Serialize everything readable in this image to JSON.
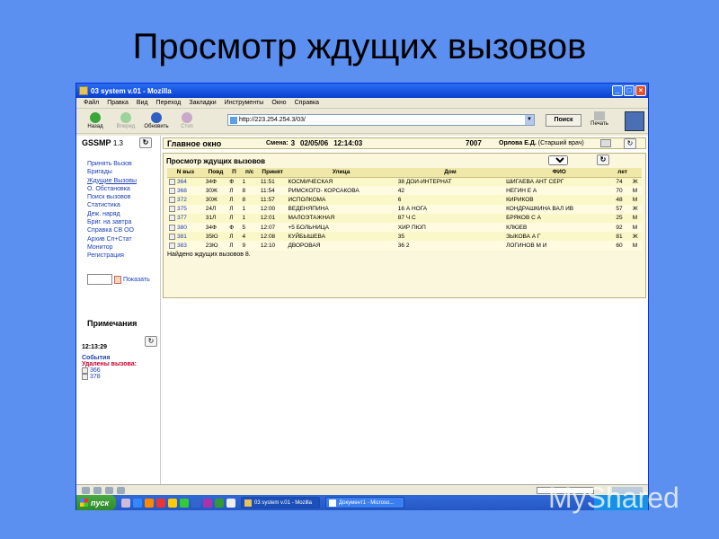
{
  "slide": {
    "title": "Просмотр ждущих вызовов"
  },
  "window": {
    "title": "03 system v.01 - Mozilla"
  },
  "menu": [
    "Файл",
    "Правка",
    "Вид",
    "Переход",
    "Закладки",
    "Инструменты",
    "Окно",
    "Справка"
  ],
  "toolbar": {
    "back": "Назад",
    "forward": "Вперед",
    "reload": "Обновить",
    "stop": "Стоп",
    "url": "http://223.254.254.3/03/",
    "search": "Поиск",
    "print": "Печать"
  },
  "left": {
    "app": "GSSMP",
    "version": "1.3",
    "nav": [
      "Принять Вызов",
      "Бригады",
      "Ждущие Вызовы",
      "О. Обстановка",
      "Поиск вызовов",
      "Статистика",
      "Деж. наряд",
      "Бриг. на завтра",
      "Справка СВ ОО",
      "Архив Сп+Стат",
      "Монитор",
      "Регистрация"
    ],
    "show_label": "Показать",
    "notes_title": "Примечания",
    "notes_time": "12:13:29",
    "events": "События",
    "deleted_label": "Удалены вызова:",
    "deleted": [
      "366",
      "378"
    ]
  },
  "header": {
    "title": "Главное окно",
    "shift_label": "Смена:",
    "shift_value": "3",
    "date": "02/05/06",
    "time": "12:14:03",
    "id": "7007",
    "user": "Орлова Е.Д.",
    "role": "(Старший врач)"
  },
  "panel": {
    "title": "Просмотр ждущих вызовов",
    "page_select": "1",
    "columns": [
      "N выз",
      "Повд",
      "П",
      "п/с",
      "Принят",
      "Улица",
      "Дом",
      "ФИО",
      "лет",
      ""
    ],
    "rows": [
      [
        "364",
        "34Ф",
        "Ф",
        "1",
        "11:51",
        "КОСМИЧЕСКАЯ",
        "38 ДОИ-ИНТЕРНАТ",
        "ШИГАЕВА АНТ СЕРГ",
        "74",
        "Ж"
      ],
      [
        "368",
        "30Ж",
        "Л",
        "8",
        "11:54",
        "РИМСКОГО- КОРСАКОВА",
        "42",
        "НЕГИН Е А",
        "70",
        "М"
      ],
      [
        "372",
        "30Ж",
        "Л",
        "8",
        "11:57",
        "ИСПОЛКОМА",
        "6",
        "КИРИКОВ",
        "48",
        "М"
      ],
      [
        "375",
        "24Л",
        "Л",
        "1",
        "12:00",
        "ВЕДЕНЯПИНА",
        "16 А НОГА",
        "КОНДРАШКИНА ВАЛ ИВ",
        "57",
        "Ж"
      ],
      [
        "377",
        "31Л",
        "Л",
        "1",
        "12:01",
        "МАЛОЭТАЖНАЯ",
        "87 Ч С",
        "БРЯКОВ С А",
        "25",
        "М"
      ],
      [
        "380",
        "34Ф",
        "Ф",
        "5",
        "12:07",
        "+5 БОЛЬНИЦА",
        "ХИР ПЮП",
        "КЛЮЕВ",
        "92",
        "М"
      ],
      [
        "381",
        "35Ю",
        "Л",
        "4",
        "12:08",
        "КУЙБЫШЕВА",
        "35",
        "ЗЫКОВА А Г",
        "81",
        "Ж"
      ],
      [
        "383",
        "23Ю",
        "Л",
        "9",
        "12:10",
        "ДВОРОВАЯ",
        "36 2",
        "ЛОГИНОВ М И",
        "60",
        "М"
      ]
    ],
    "found": "Найдено ждущих вызовов 8."
  },
  "taskbar": {
    "start": "пуск",
    "tasks": [
      "03 system v.01 - Mozilla",
      "Документ1 - Microso..."
    ]
  },
  "watermark": "MyShared"
}
